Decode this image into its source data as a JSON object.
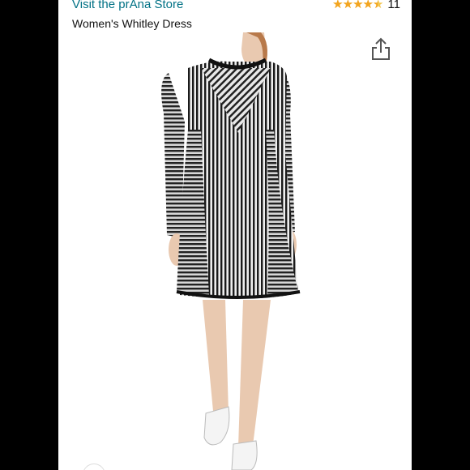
{
  "store": {
    "link_text": "Visit the prAna Store"
  },
  "rating": {
    "value": 4.5,
    "max": 5,
    "stars_glyph": "★★★★★",
    "count": "11"
  },
  "product": {
    "title": "Women's Whitley Dress"
  },
  "icons": {
    "share": "share-icon"
  },
  "colors": {
    "link": "#007185",
    "star": "#f3a41e",
    "frame": "#000000",
    "text": "#111111"
  }
}
